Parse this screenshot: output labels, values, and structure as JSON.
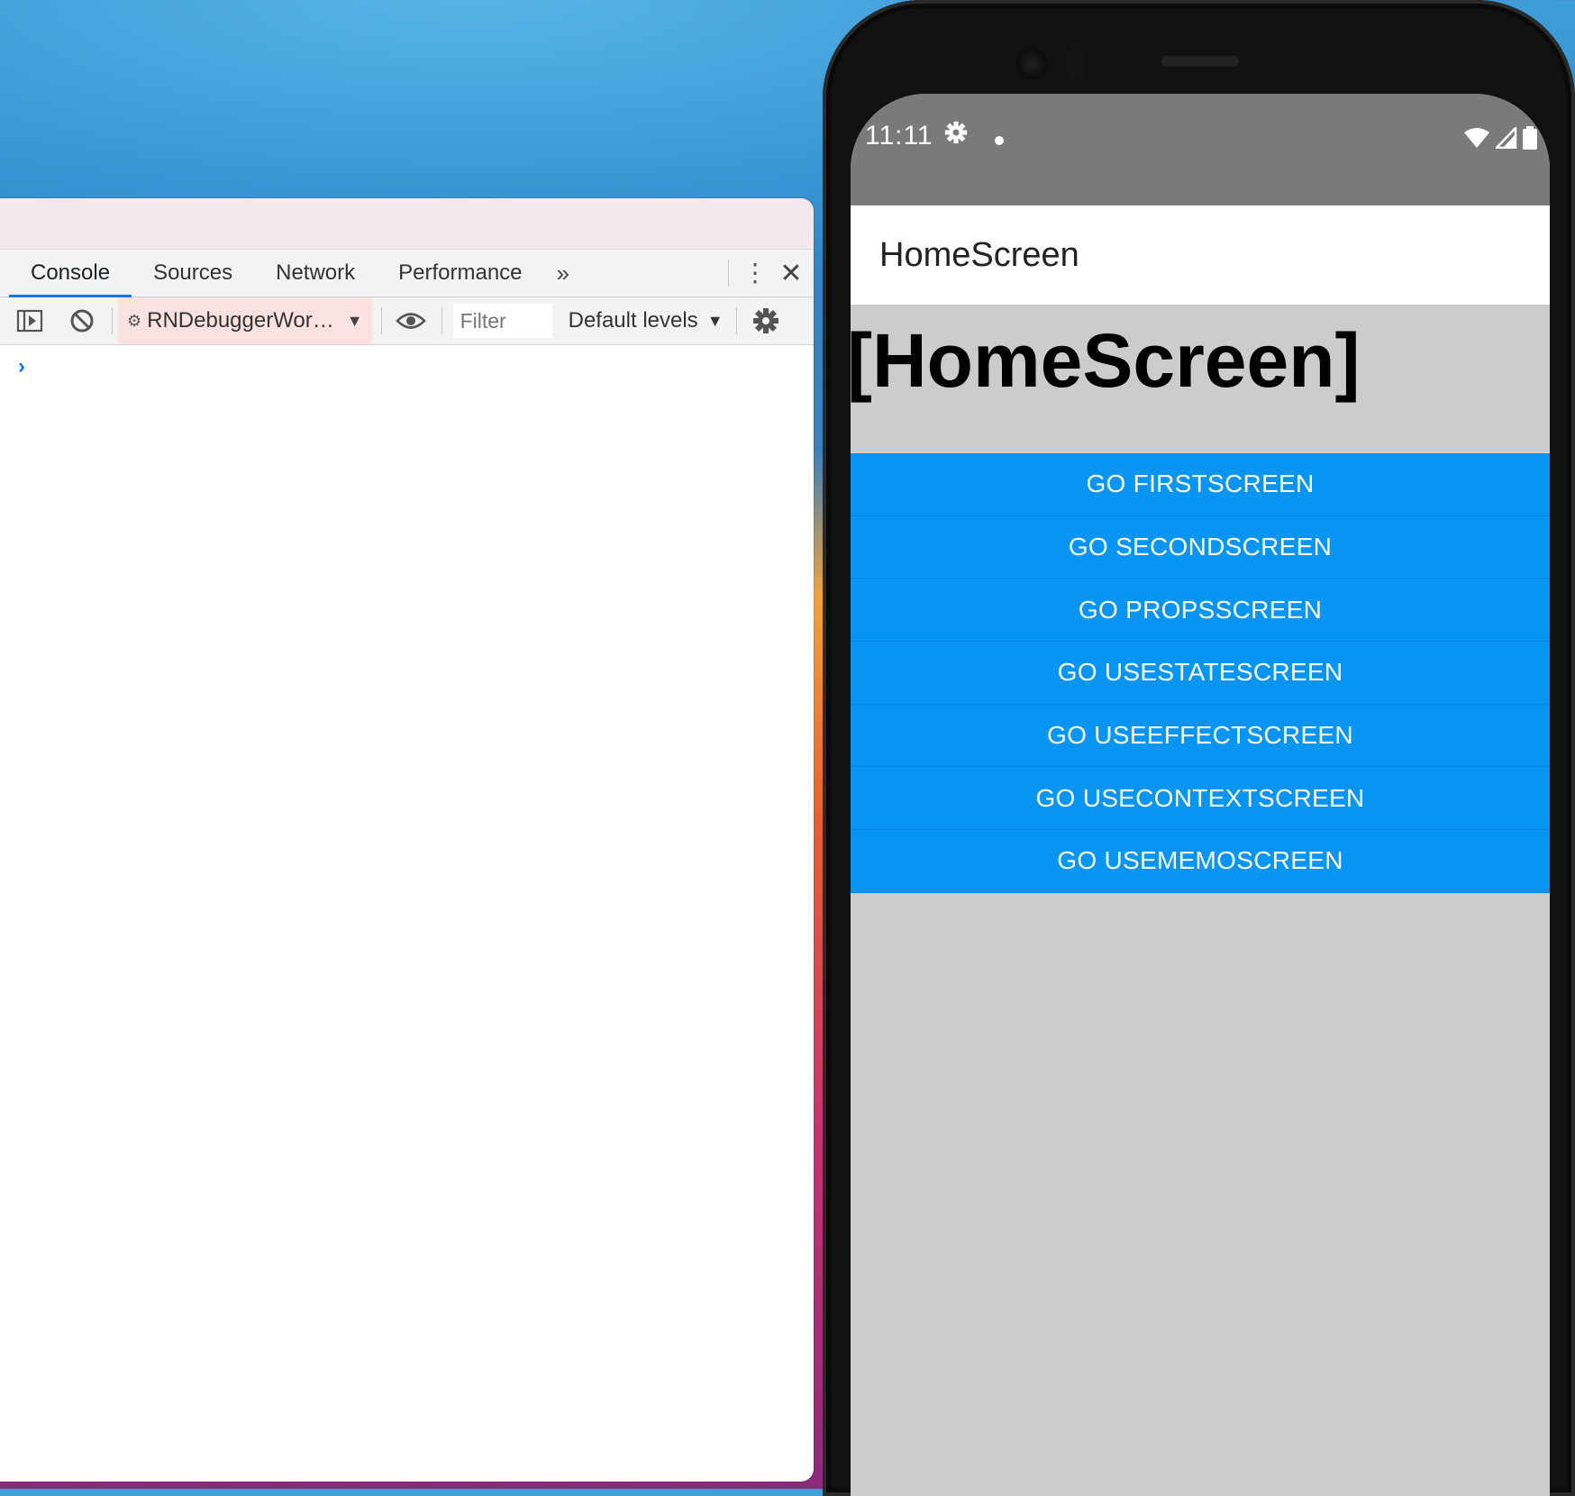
{
  "devtools": {
    "tabs": [
      {
        "label": "Console",
        "active": true
      },
      {
        "label": "Sources",
        "active": false
      },
      {
        "label": "Network",
        "active": false
      },
      {
        "label": "Performance",
        "active": false
      }
    ],
    "more_tabs_icon": "double-chevron-right-icon",
    "menu_icon": "kebab-menu-icon",
    "close_icon": "close-icon",
    "toolbar": {
      "sidebar_icon": "show-sidebar-icon",
      "clear_icon": "clear-console-icon",
      "context_label": "RNDebuggerWor…",
      "context_icon": "gear-icon",
      "live_expression_icon": "eye-icon",
      "filter_placeholder": "Filter",
      "levels_label": "Default levels",
      "settings_icon": "gear-icon"
    },
    "prompt_symbol": "›",
    "colors": {
      "active_tab_underline": "#1a73e8",
      "context_bg": "#fbe1e1"
    }
  },
  "phone": {
    "status_bar": {
      "time": "11:11",
      "icons": [
        "settings-icon",
        "notification-dot-icon",
        "wifi-icon",
        "signal-icon",
        "battery-icon"
      ]
    },
    "app_bar_title": "HomeScreen",
    "screen_heading": "[HomeScreen]",
    "buttons": [
      "GO FIRSTSCREEN",
      "GO SECONDSCREEN",
      "GO PROPSSCREEN",
      "GO USESTATESCREEN",
      "GO USEEFFECTSCREEN",
      "GO USECONTEXTSCREEN",
      "GO USEMEMOSCREEN"
    ],
    "colors": {
      "button": "#0695f3",
      "status_bar": "#7a7a7a",
      "screen_bg": "#cccccc"
    }
  }
}
